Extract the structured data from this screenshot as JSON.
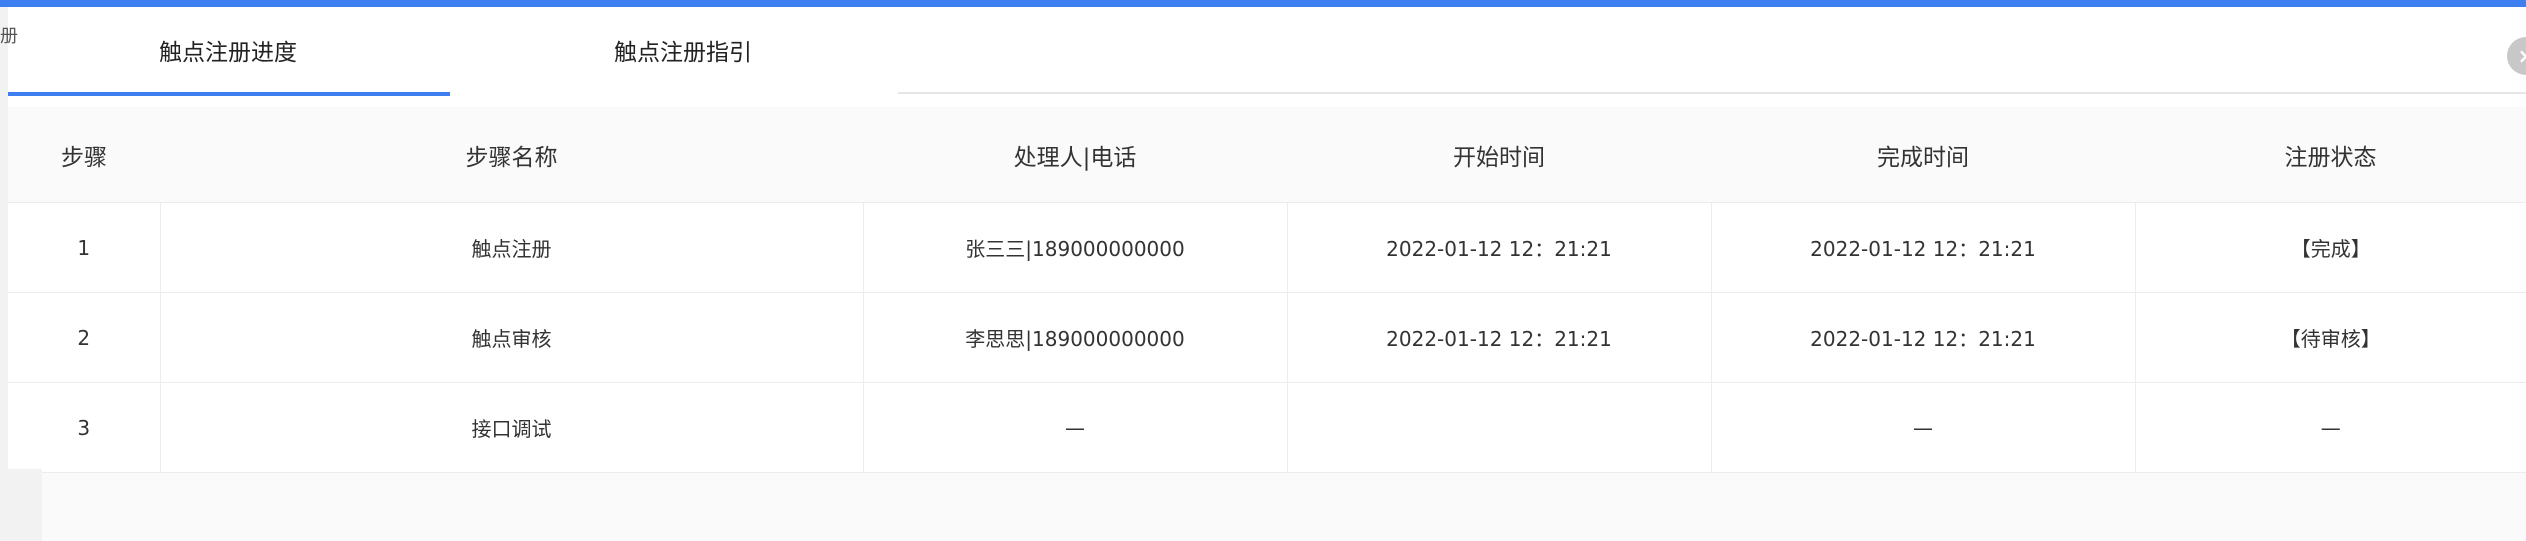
{
  "edge_label": "册",
  "tabs": [
    {
      "label": "触点注册进度",
      "active": true
    },
    {
      "label": "触点注册指引",
      "active": false
    }
  ],
  "colors": {
    "accent": "#3d7ff0"
  },
  "table": {
    "headers": [
      "步骤",
      "步骤名称",
      "处理人|电话",
      "开始时间",
      "完成时间",
      "注册状态"
    ],
    "rows": [
      [
        "1",
        "触点注册",
        "张三三|189000000000",
        "2022-01-12 12：21:21",
        "2022-01-12 12：21:21",
        "【完成】"
      ],
      [
        "2",
        "触点审核",
        "李思思|189000000000",
        "2022-01-12 12：21:21",
        "2022-01-12 12：21:21",
        "【待审核】"
      ],
      [
        "3",
        "接口调试",
        "—",
        "",
        "—",
        "—"
      ]
    ]
  }
}
